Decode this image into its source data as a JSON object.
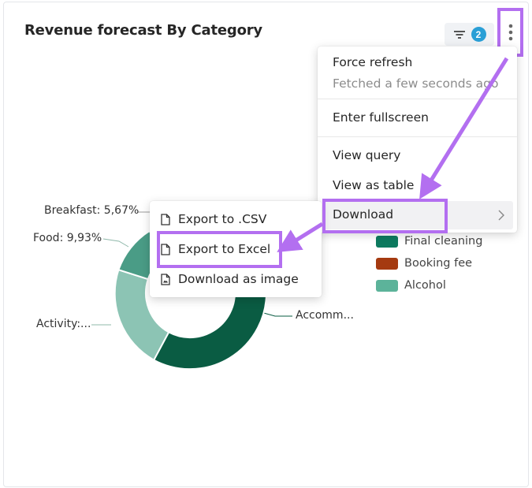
{
  "card": {
    "title": "Revenue forecast By Category",
    "filter_count": "2"
  },
  "menu": {
    "force_refresh": "Force refresh",
    "fetched_status": "Fetched a few seconds ago",
    "enter_fullscreen": "Enter fullscreen",
    "view_query": "View query",
    "view_as_table": "View as table",
    "download": "Download"
  },
  "download_menu": {
    "export_csv": "Export to .CSV",
    "export_excel": "Export to Excel",
    "download_image": "Download as image"
  },
  "legend": [
    {
      "label": "Final cleaning",
      "color": "#0d7a5f"
    },
    {
      "label": "Booking fee",
      "color": "#a53a10"
    },
    {
      "label": "Alcohol",
      "color": "#5cb39a"
    }
  ],
  "chart_labels": {
    "breakfast": "Breakfast: 5,67%",
    "food": "Food: 9,93%",
    "activity": "Activity:...",
    "accommodation": "Accomm..."
  },
  "colors": {
    "highlight": "#b36ff0",
    "accommodation": "#0a5c43",
    "activity": "#8cc4b4",
    "food": "#4a9c86",
    "breakfast": "#9aa39f"
  }
}
